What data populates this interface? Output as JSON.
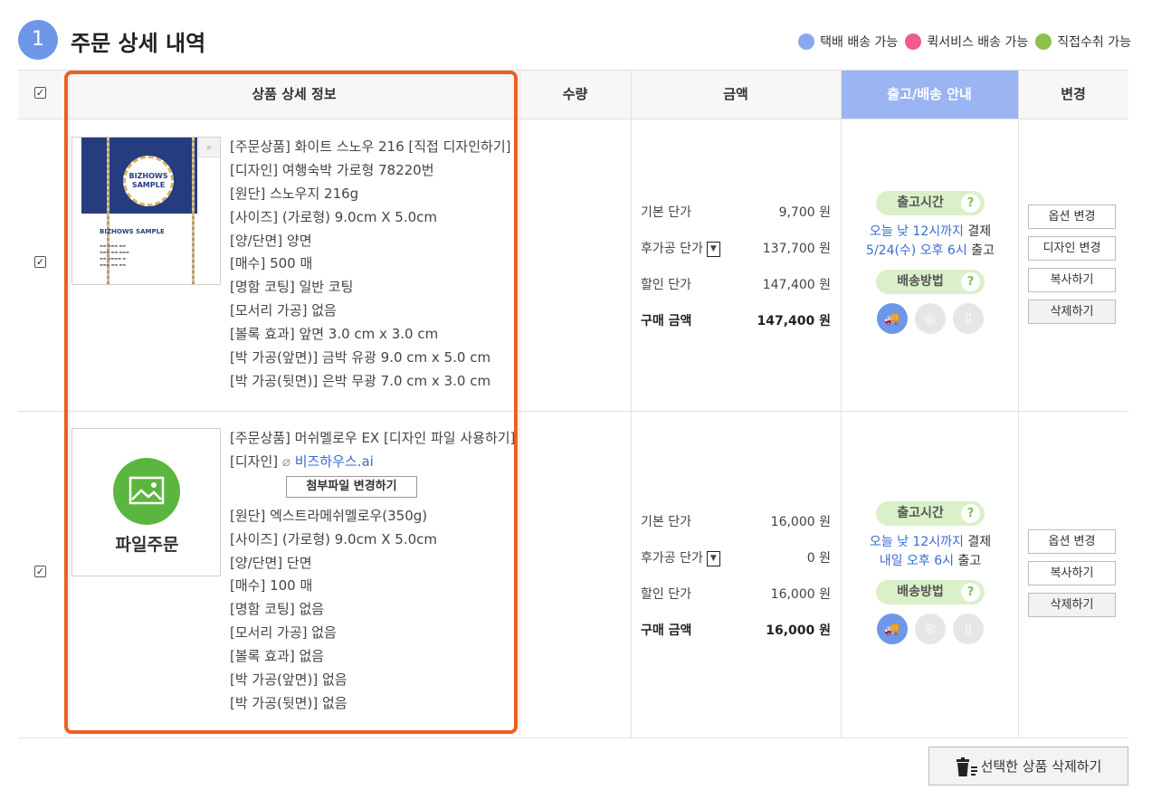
{
  "header": {
    "step": "1",
    "title": "주문 상세 내역",
    "legend": [
      {
        "label": "택배 배송 가능",
        "color": "#8aa8ef"
      },
      {
        "label": "퀵서비스 배송 가능",
        "color": "#f25a8e"
      },
      {
        "label": "직접수취 가능",
        "color": "#8bc34a"
      }
    ]
  },
  "table": {
    "columns": [
      "상품 상세 정보",
      "수량",
      "금액",
      "출고/배송 안내",
      "변경"
    ]
  },
  "rows": [
    {
      "thumb": {
        "badge": "BIZHOWS SAMPLE",
        "card_name": "BIZHOWS SAMPLE"
      },
      "specs": [
        "[주문상품] 화이트 스노우 216 [직접 디자인하기]",
        "[디자인] 여행숙박 가로형 78220번",
        "[원단] 스노우지 216g",
        "[사이즈] (가로형) 9.0cm X 5.0cm",
        "[양/단면] 양면",
        "[매수] 500 매",
        "[명함 코팅] 일반 코팅",
        "[모서리 가공] 없음",
        "[볼록 효과] 앞면 3.0 cm x 3.0 cm",
        "[박 가공(앞면)] 금박 유광 9.0 cm x 5.0 cm",
        "[박 가공(뒷면)] 은박 무광 7.0 cm x 3.0 cm"
      ],
      "prices": [
        {
          "label": "기본 단가",
          "value": "9,700 원"
        },
        {
          "label": "후가공 단가",
          "value": "137,700 원"
        },
        {
          "label": "할인 단가",
          "value": "147,400 원"
        },
        {
          "label": "구매 금액",
          "value": "147,400 원"
        }
      ],
      "ship": {
        "pill1": "출고시간",
        "line1_blue": "오늘 낮 12시까지",
        "line1_rest": " 결제",
        "line2_blue": "5/24(수) 오후 6시",
        "line2_rest": " 출고",
        "pill2": "배송방법"
      },
      "buttons": [
        "옵션 변경",
        "디자인 변경",
        "복사하기",
        "삭제하기"
      ]
    },
    {
      "thumb": {
        "label": "파일주문"
      },
      "spec_first": "[주문상품] 머쉬멜로우 EX [디자인 파일 사용하기]",
      "design_label": "[디자인]",
      "design_file": "비즈하우스.ai",
      "attach_btn": "첨부파일 변경하기",
      "specs": [
        "[원단] 엑스트라메쉬멜로우(350g)",
        "[사이즈] (가로형) 9.0cm X 5.0cm",
        "[양/단면] 단면",
        "[매수] 100 매",
        "[명함 코팅] 없음",
        "[모서리 가공] 없음",
        "[볼록 효과] 없음",
        "[박 가공(앞면)] 없음",
        "[박 가공(뒷면)] 없음"
      ],
      "prices": [
        {
          "label": "기본 단가",
          "value": "16,000 원"
        },
        {
          "label": "후가공 단가",
          "value": "0 원"
        },
        {
          "label": "할인 단가",
          "value": "16,000 원"
        },
        {
          "label": "구매 금액",
          "value": "16,000 원"
        }
      ],
      "ship": {
        "pill1": "출고시간",
        "line1_blue": "오늘 낮 12시까지",
        "line1_rest": " 결제",
        "line2_blue": "내일 오후 6시",
        "line2_rest": " 출고",
        "pill2": "배송방법"
      },
      "buttons": [
        "옵션 변경",
        "복사하기",
        "삭제하기"
      ]
    }
  ],
  "footer": {
    "delete_selected": "선택한 상품 삭제하기"
  },
  "icons": {
    "question": "?",
    "zoom": "search-icon",
    "truck": "truck-icon",
    "bike": "motorcycle-icon",
    "pickup": "pickup-icon"
  }
}
